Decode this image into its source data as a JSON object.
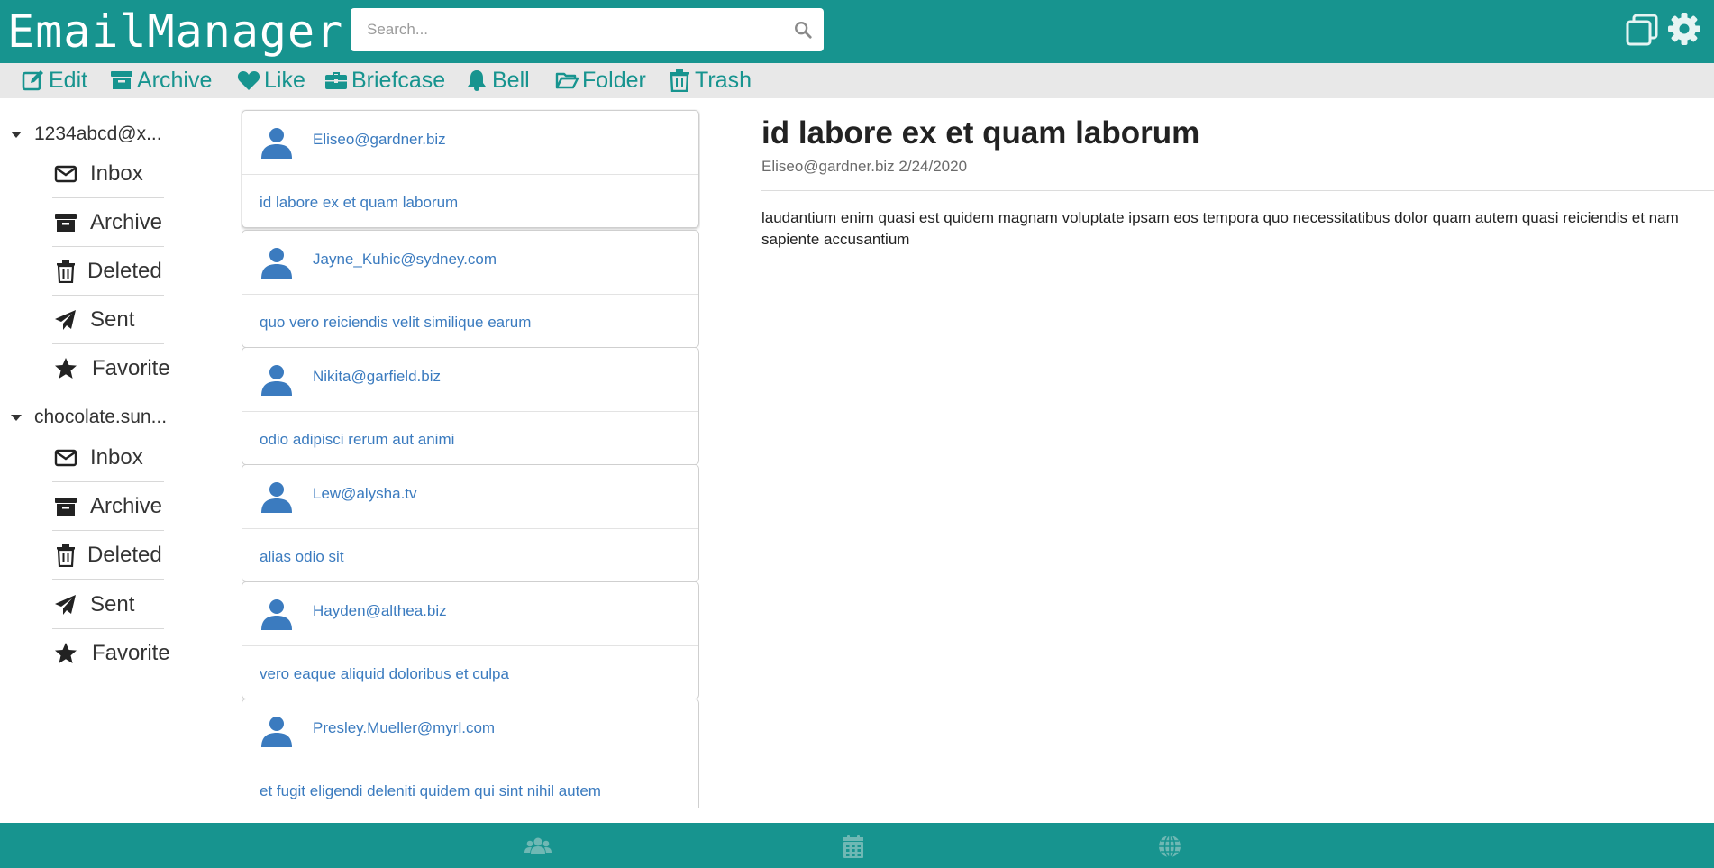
{
  "app": {
    "title": "EmailManager"
  },
  "search": {
    "placeholder": "Search...",
    "value": ""
  },
  "header": {
    "icons": [
      "search-icon",
      "window-restore-icon",
      "gear-icon"
    ]
  },
  "toolbar": {
    "items": [
      {
        "label": "Edit",
        "icon": "edit-icon"
      },
      {
        "label": "Archive",
        "icon": "archive-icon"
      },
      {
        "label": "Like",
        "icon": "heart-icon"
      },
      {
        "label": "Briefcase",
        "icon": "briefcase-icon"
      },
      {
        "label": "Bell",
        "icon": "bell-icon"
      },
      {
        "label": "Folder",
        "icon": "folder-icon"
      },
      {
        "label": "Trash",
        "icon": "trash-icon"
      }
    ]
  },
  "sidebar": {
    "accounts": [
      {
        "name": "1234abcd@x...",
        "folders": [
          {
            "label": "Inbox",
            "icon": "envelope-icon"
          },
          {
            "label": "Archive",
            "icon": "archive-icon"
          },
          {
            "label": "Deleted",
            "icon": "trash-icon"
          },
          {
            "label": "Sent",
            "icon": "paper-plane-icon"
          },
          {
            "label": "Favorite",
            "icon": "star-icon"
          }
        ]
      },
      {
        "name": "chocolate.sun...",
        "folders": [
          {
            "label": "Inbox",
            "icon": "envelope-icon"
          },
          {
            "label": "Archive",
            "icon": "archive-icon"
          },
          {
            "label": "Deleted",
            "icon": "trash-icon"
          },
          {
            "label": "Sent",
            "icon": "paper-plane-icon"
          },
          {
            "label": "Favorite",
            "icon": "star-icon"
          }
        ]
      }
    ]
  },
  "mails": [
    {
      "from": "Eliseo@gardner.biz",
      "subject": "id labore ex et quam laborum"
    },
    {
      "from": "Jayne_Kuhic@sydney.com",
      "subject": "quo vero reiciendis velit similique earum"
    },
    {
      "from": "Nikita@garfield.biz",
      "subject": "odio adipisci rerum aut animi"
    },
    {
      "from": "Lew@alysha.tv",
      "subject": "alias odio sit"
    },
    {
      "from": "Hayden@althea.biz",
      "subject": "vero eaque aliquid doloribus et culpa"
    },
    {
      "from": "Presley.Mueller@myrl.com",
      "subject": "et fugit eligendi deleniti quidem qui sint nihil autem"
    }
  ],
  "message": {
    "subject": "id labore ex et quam laborum",
    "meta": "Eliseo@gardner.biz 2/24/2020",
    "body": "laudantium enim quasi est quidem magnam voluptate ipsam eos tempora quo necessitatibus dolor quam autem quasi reiciendis et nam sapiente accusantium"
  },
  "footer": {
    "icons": [
      "users-icon",
      "calendar-icon",
      "globe-icon"
    ]
  },
  "colors": {
    "primary": "#17948f",
    "link": "#3b7bbf",
    "toolbar_bg": "#e8e8e8"
  }
}
